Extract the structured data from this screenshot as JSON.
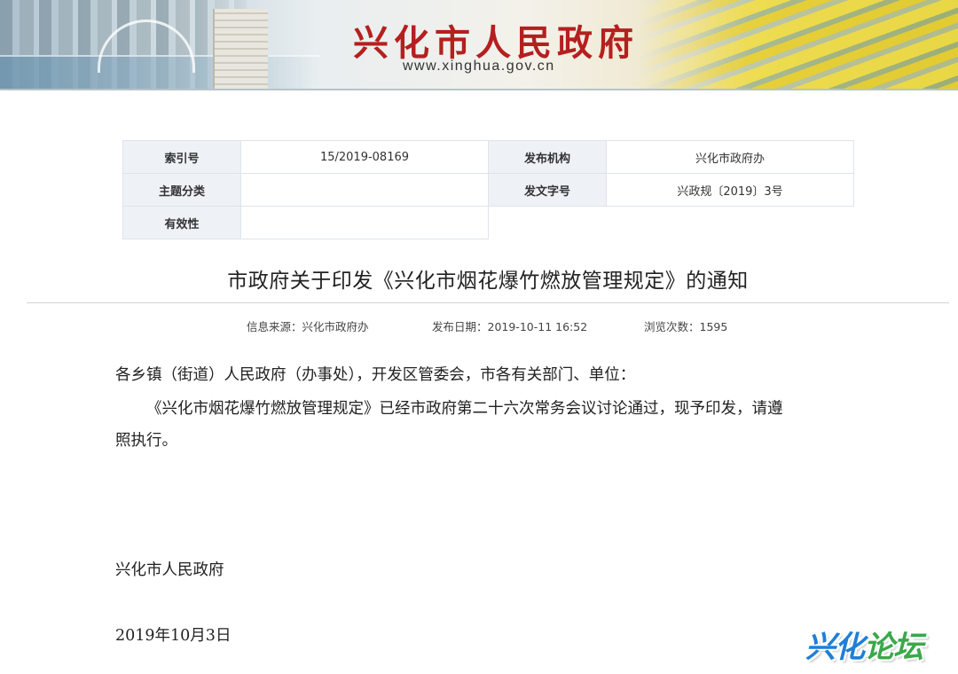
{
  "banner": {
    "site_title": "兴化市人民政府",
    "site_url": "www.xinghua.gov.cn"
  },
  "info": {
    "index_label": "索引号",
    "index_value": "15/2019-08169",
    "issuer_label": "发布机构",
    "issuer_value": "兴化市政府办",
    "topic_label": "主题分类",
    "topic_value": "",
    "docno_label": "发文字号",
    "docno_value": "兴政规〔2019〕3号",
    "validity_label": "有效性",
    "validity_value": ""
  },
  "doc": {
    "title": "市政府关于印发《兴化市烟花爆竹燃放管理规定》的通知",
    "meta": {
      "source": "信息来源：兴化市政府办",
      "date": "发布日期：2019-10-11 16:52",
      "views": "浏览次数：1595"
    },
    "salutation": "各乡镇（街道）人民政府（办事处），开发区管委会，市各有关部门、单位：",
    "para1_line1": "《兴化市烟花爆竹燃放管理规定》已经市政府第二十六次常务会议讨论通过，现予印发，请遵",
    "para1_line2": "照执行。",
    "signature": "兴化市人民政府",
    "sign_date": "2019年10月3日"
  },
  "watermark": {
    "text_part1": "兴化",
    "text_part2": "论坛"
  }
}
